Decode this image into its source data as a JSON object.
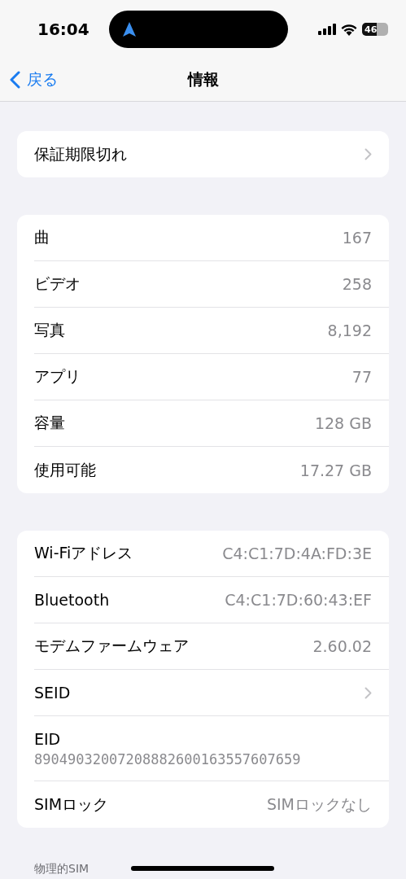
{
  "status_bar": {
    "time": "16:04",
    "battery": "46"
  },
  "nav": {
    "back": "戻る",
    "title": "情報"
  },
  "groups": [
    {
      "rows": [
        {
          "kind": "link",
          "label": "保証期限切れ"
        }
      ]
    },
    {
      "rows": [
        {
          "kind": "value",
          "label": "曲",
          "value": "167"
        },
        {
          "kind": "value",
          "label": "ビデオ",
          "value": "258"
        },
        {
          "kind": "value",
          "label": "写真",
          "value": "8,192"
        },
        {
          "kind": "value",
          "label": "アプリ",
          "value": "77"
        },
        {
          "kind": "value",
          "label": "容量",
          "value": "128 GB"
        },
        {
          "kind": "value",
          "label": "使用可能",
          "value": "17.27 GB"
        }
      ]
    },
    {
      "rows": [
        {
          "kind": "value",
          "label": "Wi-Fiアドレス",
          "value": "C4:C1:7D:4A:FD:3E"
        },
        {
          "kind": "value",
          "label": "Bluetooth",
          "value": "C4:C1:7D:60:43:EF"
        },
        {
          "kind": "value",
          "label": "モデムファームウェア",
          "value": "2.60.02"
        },
        {
          "kind": "link",
          "label": "SEID"
        },
        {
          "kind": "stacked",
          "label": "EID",
          "value": "89049032007208882600163557607659"
        },
        {
          "kind": "value",
          "label": "SIMロック",
          "value": "SIMロックなし"
        }
      ]
    }
  ],
  "section_header": "物理的SIM"
}
